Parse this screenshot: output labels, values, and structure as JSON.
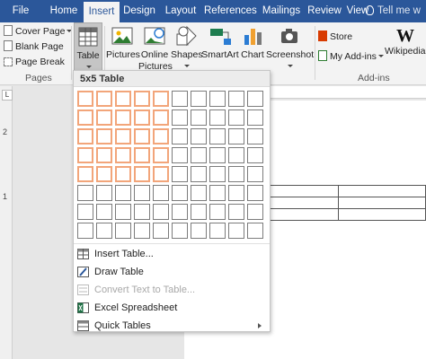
{
  "ribbon": {
    "tabs": [
      {
        "label": "File"
      },
      {
        "label": "Home"
      },
      {
        "label": "Insert",
        "active": true
      },
      {
        "label": "Design"
      },
      {
        "label": "Layout"
      },
      {
        "label": "References"
      },
      {
        "label": "Mailings"
      },
      {
        "label": "Review"
      },
      {
        "label": "View"
      }
    ],
    "tell_me": "Tell me w",
    "pages_group": {
      "label": "Pages",
      "cover_page": "Cover Page",
      "blank_page": "Blank Page",
      "page_break": "Page Break"
    },
    "table_label": "Table",
    "buttons": {
      "pictures": "Pictures",
      "online_pictures_1": "Online",
      "online_pictures_2": "Pictures",
      "shapes": "Shapes",
      "smartart": "SmartArt",
      "chart": "Chart",
      "screenshot": "Screenshot"
    },
    "addins": {
      "store": "Store",
      "my_addins": "My Add-ins",
      "wikipedia": "Wikipedia",
      "group_label": "Add-ins"
    }
  },
  "table_menu": {
    "header": "5x5 Table",
    "grid": {
      "cols": 10,
      "rows": 8,
      "selected_cols": 5,
      "selected_rows": 5
    },
    "items": [
      {
        "label": "Insert Table...",
        "icon": "insert-table-icon",
        "disabled": false
      },
      {
        "label": "Draw Table",
        "icon": "draw-table-icon",
        "disabled": false
      },
      {
        "label": "Convert Text to Table...",
        "icon": "convert-text-icon",
        "disabled": true
      },
      {
        "label": "Excel Spreadsheet",
        "icon": "excel-icon",
        "disabled": false
      },
      {
        "label": "Quick Tables",
        "icon": "quick-tables-icon",
        "disabled": false
      }
    ]
  },
  "document": {
    "ruler_corner": "L",
    "ruler_numbers": [
      "2",
      "1"
    ],
    "table_rows": 3
  },
  "colors": {
    "ribbon_blue": "#2b579a",
    "grid_highlight": "#f2a57a"
  }
}
